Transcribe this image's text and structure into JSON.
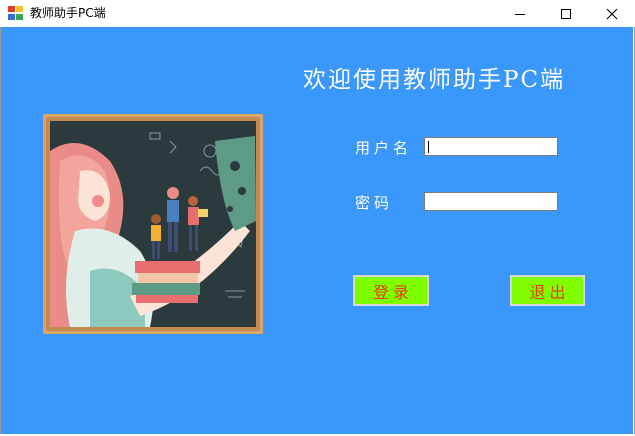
{
  "window": {
    "title": "教师助手PC端"
  },
  "main": {
    "welcome_text": "欢迎使用教师助手PC端",
    "username_label": "用户名",
    "password_label": "密码",
    "username_value": "",
    "password_value": "",
    "login_button": "登录",
    "exit_button": "退出"
  },
  "colors": {
    "background": "#3a97fb",
    "button_fill": "#7fff00",
    "button_text": "#e53b00"
  }
}
